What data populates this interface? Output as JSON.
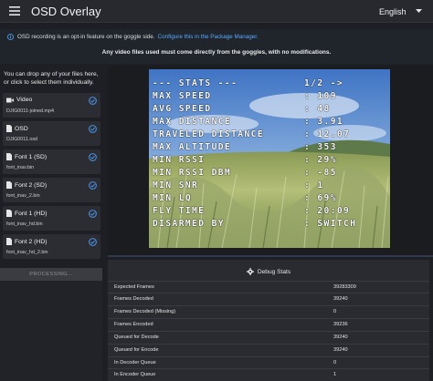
{
  "header": {
    "title": "OSD Overlay",
    "language": "English"
  },
  "info": {
    "message": "OSD recording is an opt-in feature on the goggle side.",
    "link_text": "Configure this in the Package Manager.",
    "note": "Any video files used must come directly from the goggles, with no modifications."
  },
  "sidebar": {
    "hint": "You can drop any of your files here, or click to select them individually.",
    "files": [
      {
        "label": "Video",
        "file": "DJIG0011-joined.mp4",
        "icon": "video-icon"
      },
      {
        "label": "OSD",
        "file": "DJIG0011.osd",
        "icon": "file-icon"
      },
      {
        "label": "Font 1 (SD)",
        "file": "font_inav.bin",
        "icon": "font-file-icon"
      },
      {
        "label": "Font 2 (SD)",
        "file": "font_inav_2.bin",
        "icon": "font-file-icon"
      },
      {
        "label": "Font 1 (HD)",
        "file": "font_inav_hd.bin",
        "icon": "font-file-icon"
      },
      {
        "label": "Font 2 (HD)",
        "file": "font_inav_hd_2.bin",
        "icon": "font-file-icon"
      }
    ],
    "processing_label": "PROCESSING..."
  },
  "osd": {
    "rows": [
      {
        "label": "--- STATS ---",
        "value": "1/2 ->"
      },
      {
        "label": "MAX SPEED",
        "value": ": 109"
      },
      {
        "label": "AVG SPEED",
        "value": ": 48"
      },
      {
        "label": "MAX DISTANCE",
        "value": ": 3.91"
      },
      {
        "label": "TRAVELED DISTANCE",
        "value": ": 12.07"
      },
      {
        "label": "MAX ALTITUDE",
        "value": ": 353"
      },
      {
        "label": "MIN RSSI",
        "value": ": 29%"
      },
      {
        "label": "MIN RSSI DBM",
        "value": ": -85"
      },
      {
        "label": "MIN SNR",
        "value": ": 1"
      },
      {
        "label": "MIN LQ",
        "value": ": 69%"
      },
      {
        "label": "FLY TIME",
        "value": ": 20:09"
      },
      {
        "label": "DISARMED BY",
        "value": ": SWITCH"
      }
    ]
  },
  "debug_stats": {
    "title": "Debug Stats",
    "rows": [
      {
        "key": "Expected Frames",
        "value": "39283309"
      },
      {
        "key": "Frames Decoded",
        "value": "39240"
      },
      {
        "key": "Frames Decoded (Missing)",
        "value": "0"
      },
      {
        "key": "Frames Encoded",
        "value": "39236"
      },
      {
        "key": "Queued for Decode",
        "value": "39240"
      },
      {
        "key": "Queued for Encode",
        "value": "39240"
      },
      {
        "key": "In Decoder Queue",
        "value": "0"
      },
      {
        "key": "In Encoder Queue",
        "value": "1"
      }
    ]
  },
  "colors": {
    "accent": "#5aa9ff",
    "check": "#4a90e2",
    "background": "#1e1f24"
  }
}
